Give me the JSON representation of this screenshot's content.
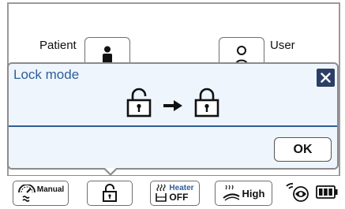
{
  "header": {
    "patient_label": "Patient",
    "user_label": "User"
  },
  "dialog": {
    "title": "Lock mode",
    "close_icon": "close-icon",
    "ok_label": "OK",
    "from_icon": "unlocked-padlock-icon",
    "arrow_icon": "right-arrow-icon",
    "to_icon": "locked-padlock-icon"
  },
  "toolbar": {
    "mode_label": "Manual",
    "lock_icon": "unlocked-padlock-icon",
    "heater_label": "Heater",
    "heater_state": "OFF",
    "flow_label": "High",
    "status_icons": [
      "wireless-icon",
      "battery-icon"
    ]
  },
  "colors": {
    "dialog_bg": "#eef5fd",
    "title_color": "#2f5e98",
    "close_bg": "#2c3e63",
    "divider": "#2f5e98"
  }
}
